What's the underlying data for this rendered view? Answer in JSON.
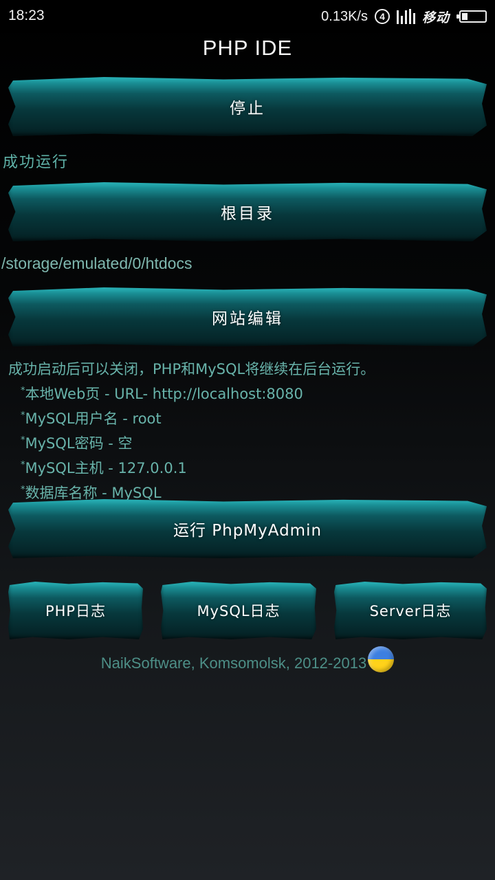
{
  "status_bar": {
    "time": "18:23",
    "net_speed": "0.13K/s",
    "sim_slot": "4",
    "carrier": "移动",
    "icons": [
      "signal-icon",
      "battery-icon"
    ]
  },
  "app": {
    "title": "PHP IDE"
  },
  "buttons": {
    "stop": "停止",
    "root_dir": "根目录",
    "site_edit": "网站编辑",
    "run_phpmyadmin": "运行 PhpMyAdmin",
    "php_log": "PHP日志",
    "mysql_log": "MySQL日志",
    "server_log": "Server日志"
  },
  "status": {
    "run_state": "成功运行",
    "root_path": "/storage/emulated/0/htdocs"
  },
  "notes": {
    "intro": "成功启动后可以关闭，PHP和MySQL将继续在后台运行。",
    "items": [
      "本地Web页 - URL- http://localhost:8080",
      "MySQL用户名 - root",
      "MySQL密码 - 空",
      "MySQL主机 - 127.0.0.1",
      "数据库名称 - MySQL"
    ],
    "bullet": "*"
  },
  "footer": {
    "credit": "NaikSoftware, Komsomolsk, 2012-2013",
    "flag_icon": "ukraine-flag-icon"
  },
  "colors": {
    "accent_teal": "#1a8f95",
    "info_text": "#5fb2a8",
    "footer_text": "#4d8f87",
    "flag_blue": "#3d7fe0",
    "flag_yellow": "#ffd21a"
  }
}
